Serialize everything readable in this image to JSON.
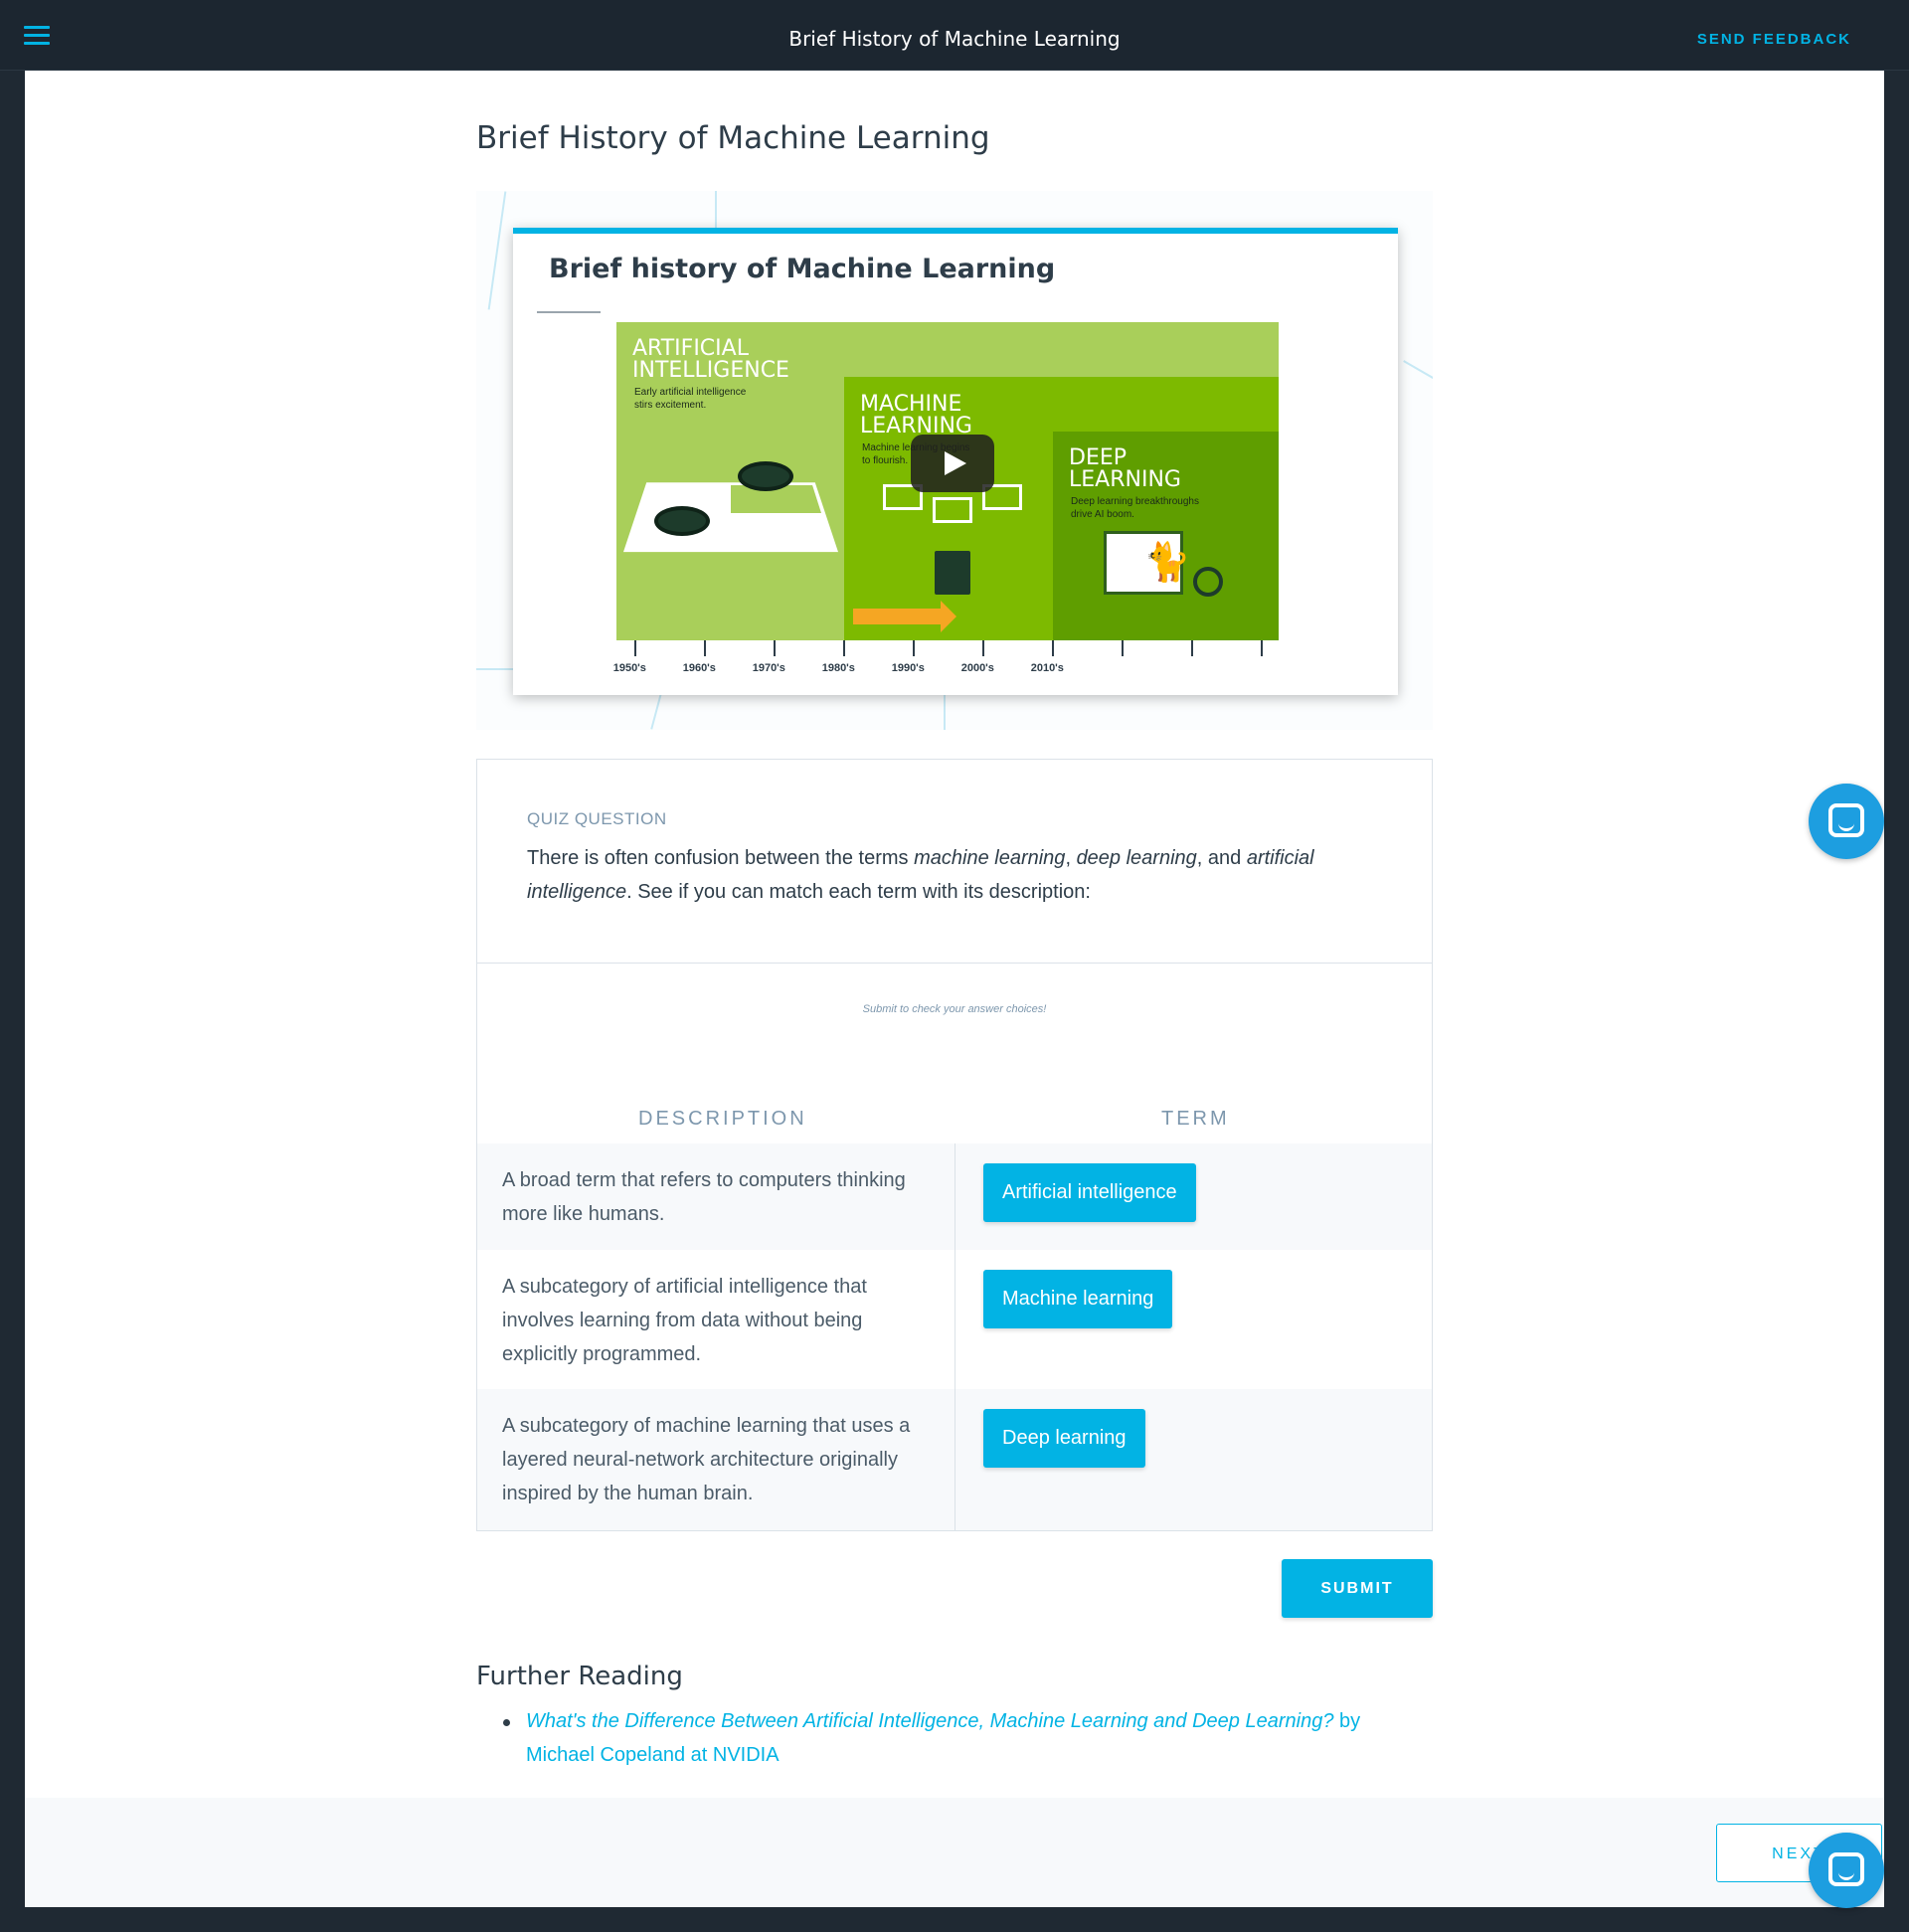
{
  "topbar": {
    "title": "Brief History of Machine Learning",
    "feedback_label": "SEND FEEDBACK"
  },
  "page": {
    "title": "Brief History of Machine Learning"
  },
  "video": {
    "heading": "Brief history of Machine Learning",
    "eras": [
      {
        "title": "ARTIFICIAL\nINTELLIGENCE",
        "subtitle": "Early artificial intelligence\nstirs excitement."
      },
      {
        "title": "MACHINE\nLEARNING",
        "subtitle": "Machine learning begins\nto flourish."
      },
      {
        "title": "DEEP\nLEARNING",
        "subtitle": "Deep learning breakthroughs\ndrive AI boom."
      }
    ],
    "timeline": [
      "1950's",
      "1960's",
      "1970's",
      "1980's",
      "1990's",
      "2000's",
      "2010's"
    ]
  },
  "quiz": {
    "label": "QUIZ QUESTION",
    "text_1": "There is often confusion between the terms ",
    "term_ml": "machine learning",
    "sep_1": ", ",
    "term_dl": "deep learning",
    "sep_2": ", and ",
    "term_ai_a": "artificial",
    "term_ai_b": "intelligence",
    "text_2": ". See if you can match each term with its description:",
    "hint": "Submit to check your answer choices!",
    "col_description": "DESCRIPTION",
    "col_term": "TERM",
    "rows": [
      {
        "description": "A broad term that refers to computers thinking more like humans.",
        "term": "Artificial intelligence"
      },
      {
        "description": "A subcategory of artificial intelligence that involves learning from data without being explicitly programmed.",
        "term": "Machine learning"
      },
      {
        "description": "A subcategory of machine learning that uses a layered neural-network architecture originally inspired by the human brain.",
        "term": "Deep learning"
      }
    ],
    "submit_label": "SUBMIT"
  },
  "further_reading": {
    "title": "Further Reading",
    "link_title": "What's the Difference Between Artificial Intelligence, Machine Learning and Deep Learning?",
    "link_suffix": " by Michael Copeland at NVIDIA"
  },
  "footer": {
    "next_label": "NEXT"
  },
  "colors": {
    "accent": "#02b3e4",
    "topbar": "#1c2630",
    "ai_green": "#a9cf5a",
    "ml_green": "#7dba00",
    "dl_green": "#5f9e00"
  },
  "icons": [
    "hamburger-menu-icon",
    "play-icon",
    "chat-icon"
  ]
}
